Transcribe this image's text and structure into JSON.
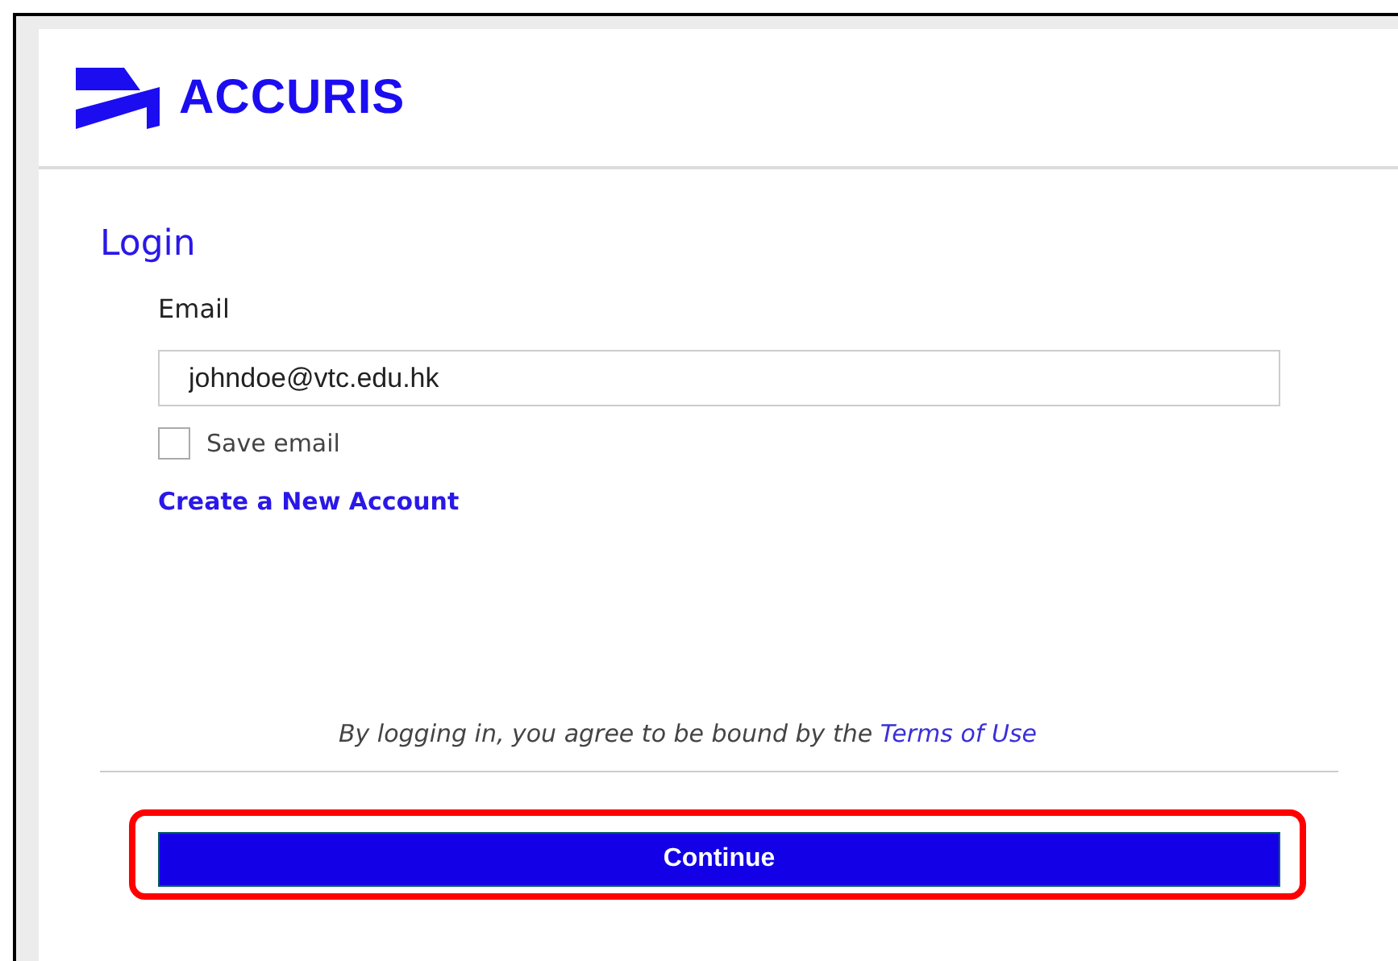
{
  "brand": {
    "name": "ACCURIS"
  },
  "login": {
    "title": "Login",
    "email_label": "Email",
    "email_value": "johndoe@vtc.edu.hk",
    "save_email": {
      "label": "Save email",
      "checked": false
    },
    "create_account": "Create a New Account"
  },
  "terms": {
    "text": "By logging in, you agree to be bound by the",
    "link": "Terms of Use"
  },
  "continue_button": {
    "label": "Continue",
    "highlighted": true
  }
}
